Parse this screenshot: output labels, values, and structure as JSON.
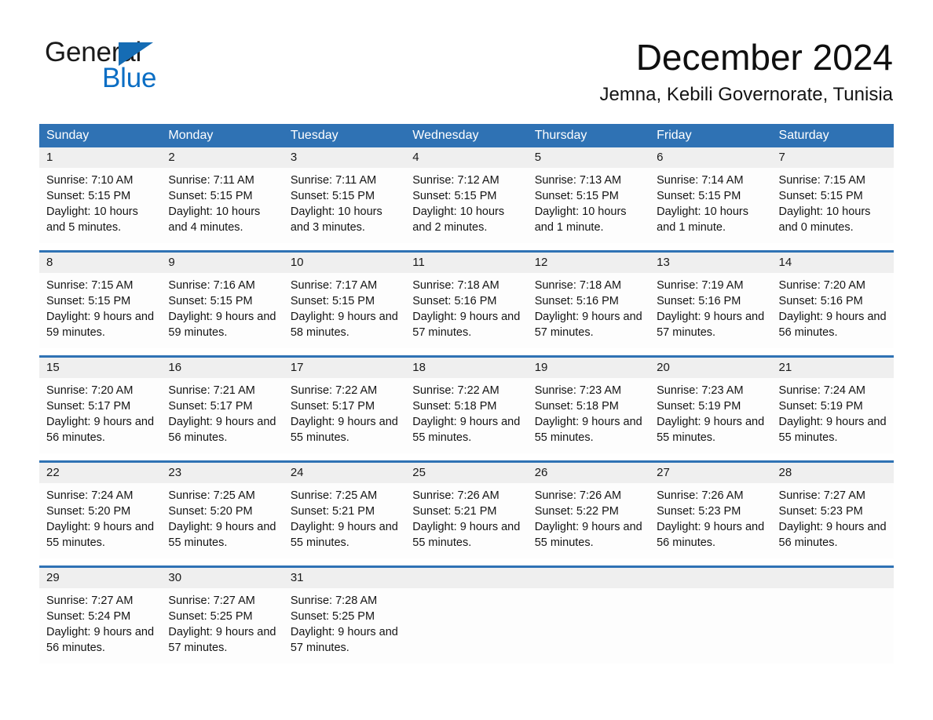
{
  "logo": {
    "line1": "General",
    "line2": "Blue",
    "triangle_color": "#156cb4",
    "blue_text_color": "#0b6ec4"
  },
  "header": {
    "title": "December 2024",
    "subtitle": "Jemna, Kebili Governorate, Tunisia"
  },
  "theme": {
    "header_blue": "#2f72b4",
    "daynum_gray": "#efefef",
    "row_divider_blue": "#2f72b4"
  },
  "weekdays": [
    "Sunday",
    "Monday",
    "Tuesday",
    "Wednesday",
    "Thursday",
    "Friday",
    "Saturday"
  ],
  "weeks": [
    [
      {
        "day": "1",
        "sunrise": "Sunrise: 7:10 AM",
        "sunset": "Sunset: 5:15 PM",
        "daylight": "Daylight: 10 hours and 5 minutes."
      },
      {
        "day": "2",
        "sunrise": "Sunrise: 7:11 AM",
        "sunset": "Sunset: 5:15 PM",
        "daylight": "Daylight: 10 hours and 4 minutes."
      },
      {
        "day": "3",
        "sunrise": "Sunrise: 7:11 AM",
        "sunset": "Sunset: 5:15 PM",
        "daylight": "Daylight: 10 hours and 3 minutes."
      },
      {
        "day": "4",
        "sunrise": "Sunrise: 7:12 AM",
        "sunset": "Sunset: 5:15 PM",
        "daylight": "Daylight: 10 hours and 2 minutes."
      },
      {
        "day": "5",
        "sunrise": "Sunrise: 7:13 AM",
        "sunset": "Sunset: 5:15 PM",
        "daylight": "Daylight: 10 hours and 1 minute."
      },
      {
        "day": "6",
        "sunrise": "Sunrise: 7:14 AM",
        "sunset": "Sunset: 5:15 PM",
        "daylight": "Daylight: 10 hours and 1 minute."
      },
      {
        "day": "7",
        "sunrise": "Sunrise: 7:15 AM",
        "sunset": "Sunset: 5:15 PM",
        "daylight": "Daylight: 10 hours and 0 minutes."
      }
    ],
    [
      {
        "day": "8",
        "sunrise": "Sunrise: 7:15 AM",
        "sunset": "Sunset: 5:15 PM",
        "daylight": "Daylight: 9 hours and 59 minutes."
      },
      {
        "day": "9",
        "sunrise": "Sunrise: 7:16 AM",
        "sunset": "Sunset: 5:15 PM",
        "daylight": "Daylight: 9 hours and 59 minutes."
      },
      {
        "day": "10",
        "sunrise": "Sunrise: 7:17 AM",
        "sunset": "Sunset: 5:15 PM",
        "daylight": "Daylight: 9 hours and 58 minutes."
      },
      {
        "day": "11",
        "sunrise": "Sunrise: 7:18 AM",
        "sunset": "Sunset: 5:16 PM",
        "daylight": "Daylight: 9 hours and 57 minutes."
      },
      {
        "day": "12",
        "sunrise": "Sunrise: 7:18 AM",
        "sunset": "Sunset: 5:16 PM",
        "daylight": "Daylight: 9 hours and 57 minutes."
      },
      {
        "day": "13",
        "sunrise": "Sunrise: 7:19 AM",
        "sunset": "Sunset: 5:16 PM",
        "daylight": "Daylight: 9 hours and 57 minutes."
      },
      {
        "day": "14",
        "sunrise": "Sunrise: 7:20 AM",
        "sunset": "Sunset: 5:16 PM",
        "daylight": "Daylight: 9 hours and 56 minutes."
      }
    ],
    [
      {
        "day": "15",
        "sunrise": "Sunrise: 7:20 AM",
        "sunset": "Sunset: 5:17 PM",
        "daylight": "Daylight: 9 hours and 56 minutes."
      },
      {
        "day": "16",
        "sunrise": "Sunrise: 7:21 AM",
        "sunset": "Sunset: 5:17 PM",
        "daylight": "Daylight: 9 hours and 56 minutes."
      },
      {
        "day": "17",
        "sunrise": "Sunrise: 7:22 AM",
        "sunset": "Sunset: 5:17 PM",
        "daylight": "Daylight: 9 hours and 55 minutes."
      },
      {
        "day": "18",
        "sunrise": "Sunrise: 7:22 AM",
        "sunset": "Sunset: 5:18 PM",
        "daylight": "Daylight: 9 hours and 55 minutes."
      },
      {
        "day": "19",
        "sunrise": "Sunrise: 7:23 AM",
        "sunset": "Sunset: 5:18 PM",
        "daylight": "Daylight: 9 hours and 55 minutes."
      },
      {
        "day": "20",
        "sunrise": "Sunrise: 7:23 AM",
        "sunset": "Sunset: 5:19 PM",
        "daylight": "Daylight: 9 hours and 55 minutes."
      },
      {
        "day": "21",
        "sunrise": "Sunrise: 7:24 AM",
        "sunset": "Sunset: 5:19 PM",
        "daylight": "Daylight: 9 hours and 55 minutes."
      }
    ],
    [
      {
        "day": "22",
        "sunrise": "Sunrise: 7:24 AM",
        "sunset": "Sunset: 5:20 PM",
        "daylight": "Daylight: 9 hours and 55 minutes."
      },
      {
        "day": "23",
        "sunrise": "Sunrise: 7:25 AM",
        "sunset": "Sunset: 5:20 PM",
        "daylight": "Daylight: 9 hours and 55 minutes."
      },
      {
        "day": "24",
        "sunrise": "Sunrise: 7:25 AM",
        "sunset": "Sunset: 5:21 PM",
        "daylight": "Daylight: 9 hours and 55 minutes."
      },
      {
        "day": "25",
        "sunrise": "Sunrise: 7:26 AM",
        "sunset": "Sunset: 5:21 PM",
        "daylight": "Daylight: 9 hours and 55 minutes."
      },
      {
        "day": "26",
        "sunrise": "Sunrise: 7:26 AM",
        "sunset": "Sunset: 5:22 PM",
        "daylight": "Daylight: 9 hours and 55 minutes."
      },
      {
        "day": "27",
        "sunrise": "Sunrise: 7:26 AM",
        "sunset": "Sunset: 5:23 PM",
        "daylight": "Daylight: 9 hours and 56 minutes."
      },
      {
        "day": "28",
        "sunrise": "Sunrise: 7:27 AM",
        "sunset": "Sunset: 5:23 PM",
        "daylight": "Daylight: 9 hours and 56 minutes."
      }
    ],
    [
      {
        "day": "29",
        "sunrise": "Sunrise: 7:27 AM",
        "sunset": "Sunset: 5:24 PM",
        "daylight": "Daylight: 9 hours and 56 minutes."
      },
      {
        "day": "30",
        "sunrise": "Sunrise: 7:27 AM",
        "sunset": "Sunset: 5:25 PM",
        "daylight": "Daylight: 9 hours and 57 minutes."
      },
      {
        "day": "31",
        "sunrise": "Sunrise: 7:28 AM",
        "sunset": "Sunset: 5:25 PM",
        "daylight": "Daylight: 9 hours and 57 minutes."
      },
      {
        "day": "",
        "sunrise": "",
        "sunset": "",
        "daylight": ""
      },
      {
        "day": "",
        "sunrise": "",
        "sunset": "",
        "daylight": ""
      },
      {
        "day": "",
        "sunrise": "",
        "sunset": "",
        "daylight": ""
      },
      {
        "day": "",
        "sunrise": "",
        "sunset": "",
        "daylight": ""
      }
    ]
  ]
}
